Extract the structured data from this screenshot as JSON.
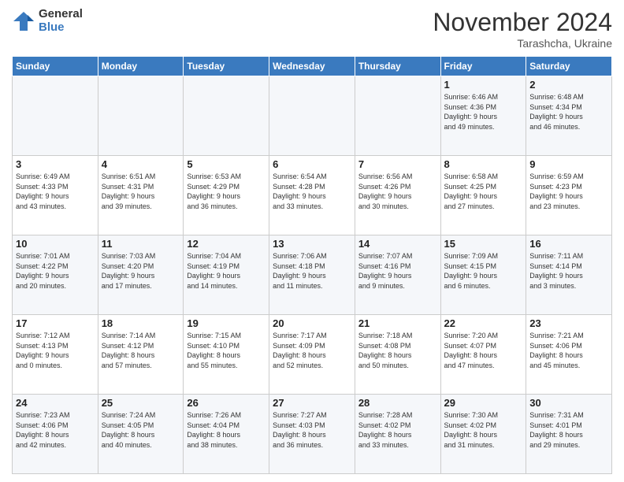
{
  "logo": {
    "general": "General",
    "blue": "Blue"
  },
  "header": {
    "month": "November 2024",
    "location": "Tarashcha, Ukraine"
  },
  "weekdays": [
    "Sunday",
    "Monday",
    "Tuesday",
    "Wednesday",
    "Thursday",
    "Friday",
    "Saturday"
  ],
  "weeks": [
    [
      {
        "day": "",
        "info": ""
      },
      {
        "day": "",
        "info": ""
      },
      {
        "day": "",
        "info": ""
      },
      {
        "day": "",
        "info": ""
      },
      {
        "day": "",
        "info": ""
      },
      {
        "day": "1",
        "info": "Sunrise: 6:46 AM\nSunset: 4:36 PM\nDaylight: 9 hours\nand 49 minutes."
      },
      {
        "day": "2",
        "info": "Sunrise: 6:48 AM\nSunset: 4:34 PM\nDaylight: 9 hours\nand 46 minutes."
      }
    ],
    [
      {
        "day": "3",
        "info": "Sunrise: 6:49 AM\nSunset: 4:33 PM\nDaylight: 9 hours\nand 43 minutes."
      },
      {
        "day": "4",
        "info": "Sunrise: 6:51 AM\nSunset: 4:31 PM\nDaylight: 9 hours\nand 39 minutes."
      },
      {
        "day": "5",
        "info": "Sunrise: 6:53 AM\nSunset: 4:29 PM\nDaylight: 9 hours\nand 36 minutes."
      },
      {
        "day": "6",
        "info": "Sunrise: 6:54 AM\nSunset: 4:28 PM\nDaylight: 9 hours\nand 33 minutes."
      },
      {
        "day": "7",
        "info": "Sunrise: 6:56 AM\nSunset: 4:26 PM\nDaylight: 9 hours\nand 30 minutes."
      },
      {
        "day": "8",
        "info": "Sunrise: 6:58 AM\nSunset: 4:25 PM\nDaylight: 9 hours\nand 27 minutes."
      },
      {
        "day": "9",
        "info": "Sunrise: 6:59 AM\nSunset: 4:23 PM\nDaylight: 9 hours\nand 23 minutes."
      }
    ],
    [
      {
        "day": "10",
        "info": "Sunrise: 7:01 AM\nSunset: 4:22 PM\nDaylight: 9 hours\nand 20 minutes."
      },
      {
        "day": "11",
        "info": "Sunrise: 7:03 AM\nSunset: 4:20 PM\nDaylight: 9 hours\nand 17 minutes."
      },
      {
        "day": "12",
        "info": "Sunrise: 7:04 AM\nSunset: 4:19 PM\nDaylight: 9 hours\nand 14 minutes."
      },
      {
        "day": "13",
        "info": "Sunrise: 7:06 AM\nSunset: 4:18 PM\nDaylight: 9 hours\nand 11 minutes."
      },
      {
        "day": "14",
        "info": "Sunrise: 7:07 AM\nSunset: 4:16 PM\nDaylight: 9 hours\nand 9 minutes."
      },
      {
        "day": "15",
        "info": "Sunrise: 7:09 AM\nSunset: 4:15 PM\nDaylight: 9 hours\nand 6 minutes."
      },
      {
        "day": "16",
        "info": "Sunrise: 7:11 AM\nSunset: 4:14 PM\nDaylight: 9 hours\nand 3 minutes."
      }
    ],
    [
      {
        "day": "17",
        "info": "Sunrise: 7:12 AM\nSunset: 4:13 PM\nDaylight: 9 hours\nand 0 minutes."
      },
      {
        "day": "18",
        "info": "Sunrise: 7:14 AM\nSunset: 4:12 PM\nDaylight: 8 hours\nand 57 minutes."
      },
      {
        "day": "19",
        "info": "Sunrise: 7:15 AM\nSunset: 4:10 PM\nDaylight: 8 hours\nand 55 minutes."
      },
      {
        "day": "20",
        "info": "Sunrise: 7:17 AM\nSunset: 4:09 PM\nDaylight: 8 hours\nand 52 minutes."
      },
      {
        "day": "21",
        "info": "Sunrise: 7:18 AM\nSunset: 4:08 PM\nDaylight: 8 hours\nand 50 minutes."
      },
      {
        "day": "22",
        "info": "Sunrise: 7:20 AM\nSunset: 4:07 PM\nDaylight: 8 hours\nand 47 minutes."
      },
      {
        "day": "23",
        "info": "Sunrise: 7:21 AM\nSunset: 4:06 PM\nDaylight: 8 hours\nand 45 minutes."
      }
    ],
    [
      {
        "day": "24",
        "info": "Sunrise: 7:23 AM\nSunset: 4:06 PM\nDaylight: 8 hours\nand 42 minutes."
      },
      {
        "day": "25",
        "info": "Sunrise: 7:24 AM\nSunset: 4:05 PM\nDaylight: 8 hours\nand 40 minutes."
      },
      {
        "day": "26",
        "info": "Sunrise: 7:26 AM\nSunset: 4:04 PM\nDaylight: 8 hours\nand 38 minutes."
      },
      {
        "day": "27",
        "info": "Sunrise: 7:27 AM\nSunset: 4:03 PM\nDaylight: 8 hours\nand 36 minutes."
      },
      {
        "day": "28",
        "info": "Sunrise: 7:28 AM\nSunset: 4:02 PM\nDaylight: 8 hours\nand 33 minutes."
      },
      {
        "day": "29",
        "info": "Sunrise: 7:30 AM\nSunset: 4:02 PM\nDaylight: 8 hours\nand 31 minutes."
      },
      {
        "day": "30",
        "info": "Sunrise: 7:31 AM\nSunset: 4:01 PM\nDaylight: 8 hours\nand 29 minutes."
      }
    ]
  ]
}
